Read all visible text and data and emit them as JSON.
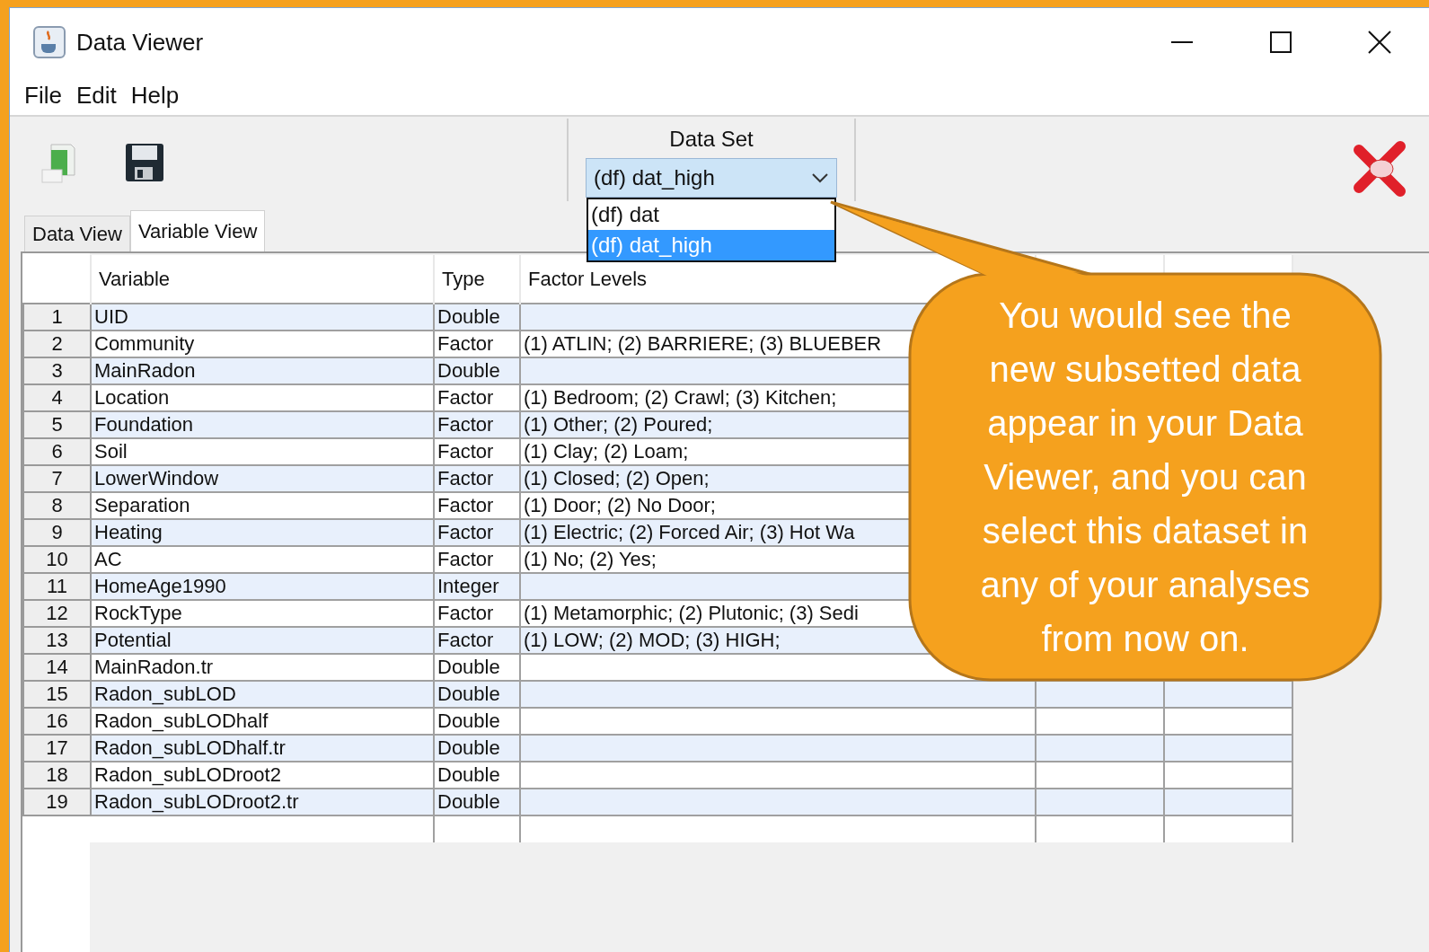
{
  "window": {
    "title": "Data Viewer"
  },
  "menu": [
    "File",
    "Edit",
    "Help"
  ],
  "dataset": {
    "label": "Data Set",
    "value": "(df) dat_high",
    "options": [
      {
        "label": "(df) dat",
        "selected": false
      },
      {
        "label": "(df) dat_high",
        "selected": true
      }
    ]
  },
  "tabs": [
    {
      "label": "Data View",
      "selected": false
    },
    {
      "label": "Variable View",
      "selected": true
    }
  ],
  "table": {
    "columns": [
      "Variable",
      "Type",
      "Factor Levels"
    ],
    "rows": [
      {
        "number": "1",
        "variable": "UID",
        "type": "Double"
      },
      {
        "number": "2",
        "variable": "Community",
        "type": "Factor",
        "levels": "(1) ATLIN; (2) BARRIERE; (3) BLUEBER"
      },
      {
        "number": "3",
        "variable": "MainRadon",
        "type": "Double"
      },
      {
        "number": "4",
        "variable": "Location",
        "type": "Factor",
        "levels": "(1) Bedroom; (2) Crawl; (3) Kitchen;"
      },
      {
        "number": "5",
        "variable": "Foundation",
        "type": "Factor",
        "levels": "(1) Other; (2) Poured;"
      },
      {
        "number": "6",
        "variable": "Soil",
        "type": "Factor",
        "levels": "(1) Clay; (2) Loam;"
      },
      {
        "number": "7",
        "variable": "LowerWindow",
        "type": "Factor",
        "levels": "(1) Closed; (2) Open;"
      },
      {
        "number": "8",
        "variable": "Separation",
        "type": "Factor",
        "levels": "(1) Door; (2) No Door;"
      },
      {
        "number": "9",
        "variable": "Heating",
        "type": "Factor",
        "levels": "(1) Electric; (2) Forced Air; (3) Hot Wa"
      },
      {
        "number": "10",
        "variable": "AC",
        "type": "Factor",
        "levels": "(1) No; (2) Yes;"
      },
      {
        "number": "11",
        "variable": "HomeAge1990",
        "type": "Integer"
      },
      {
        "number": "12",
        "variable": "RockType",
        "type": "Factor",
        "levels": "(1) Metamorphic; (2) Plutonic; (3) Sedi"
      },
      {
        "number": "13",
        "variable": "Potential",
        "type": "Factor",
        "levels": "(1) LOW; (2) MOD; (3) HIGH;"
      },
      {
        "number": "14",
        "variable": "MainRadon.tr",
        "type": "Double"
      },
      {
        "number": "15",
        "variable": "Radon_subLOD",
        "type": "Double"
      },
      {
        "number": "16",
        "variable": "Radon_subLODhalf",
        "type": "Double"
      },
      {
        "number": "17",
        "variable": "Radon_subLODhalf.tr",
        "type": "Double"
      },
      {
        "number": "18",
        "variable": "Radon_subLODroot2",
        "type": "Double"
      },
      {
        "number": "19",
        "variable": "Radon_subLODroot2.tr",
        "type": "Double"
      }
    ]
  },
  "callout": {
    "text": "You would see the new subsetted data appear in your Data Viewer, and you can select this dataset in any of your analyses from now on."
  }
}
